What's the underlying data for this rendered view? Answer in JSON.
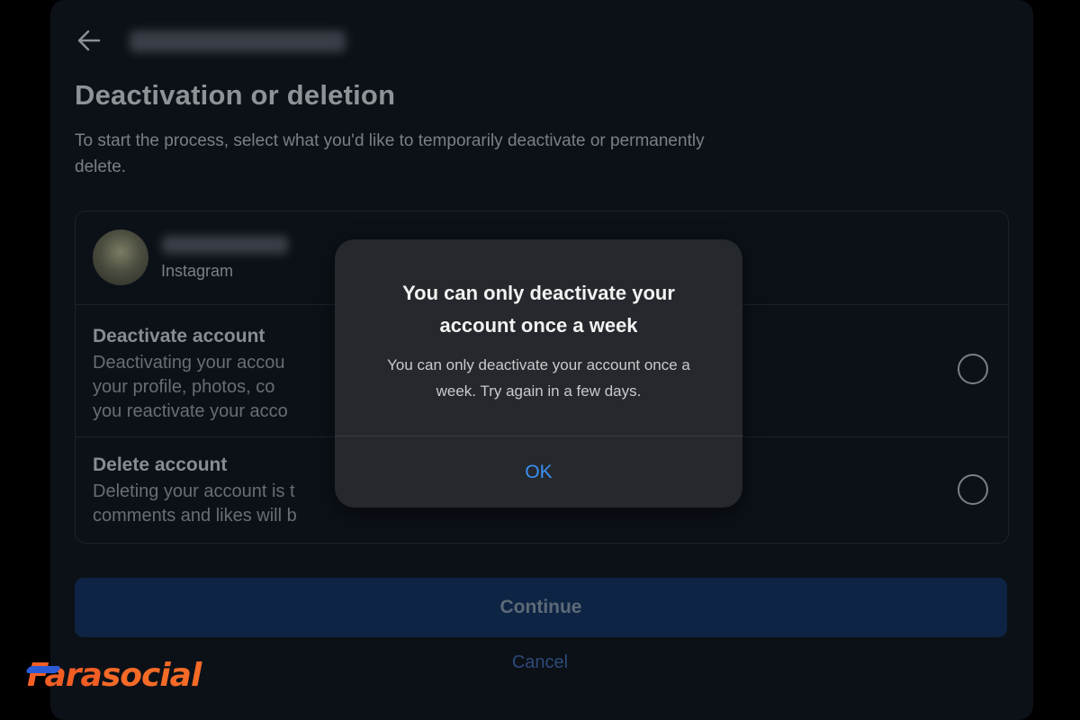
{
  "header": {
    "back_icon": "arrow-left-icon",
    "title": "Deactivation or deletion",
    "subtitle": "To start the process, select what you'd like to temporarily deactivate or permanently delete."
  },
  "account": {
    "platform": "Instagram"
  },
  "options": [
    {
      "title": "Deactivate account",
      "description_lines": [
        "Deactivating your accou",
        "your profile, photos, co",
        "you reactivate your acco"
      ]
    },
    {
      "title": "Delete account",
      "description_lines": [
        "Deleting your account is t",
        "comments and likes will b"
      ]
    }
  ],
  "buttons": {
    "continue_label": "Continue",
    "cancel_label": "Cancel"
  },
  "modal": {
    "title": "You can only deactivate your account once a week",
    "message": "You can only deactivate your account once a week. Try again in a few days.",
    "ok_label": "OK"
  },
  "branding": {
    "logo_part1": "Fara",
    "logo_part2": "social"
  },
  "colors": {
    "background": "#000000",
    "panel": "#0c1118",
    "modal": "#25282c",
    "accent_blue": "#3c8ff4",
    "brand_orange": "#f25e24"
  }
}
